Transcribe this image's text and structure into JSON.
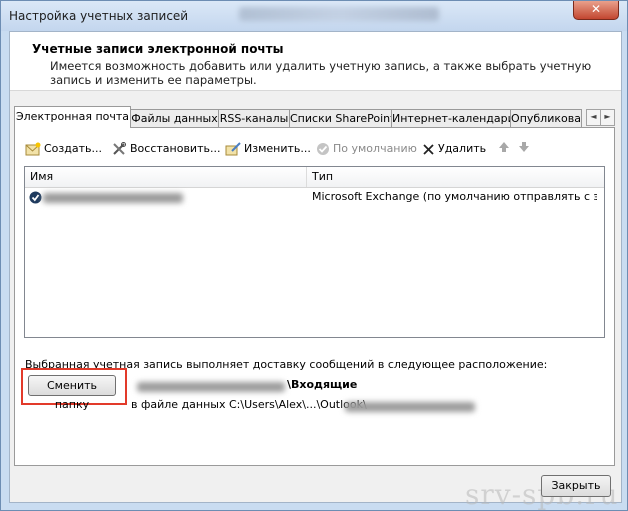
{
  "window": {
    "title": "Настройка учетных записей",
    "close_glyph": "✕"
  },
  "header": {
    "title": "Учетные записи электронной почты",
    "description": "Имеется возможность добавить или удалить учетную запись, а также выбрать учетную запись и изменить ее параметры."
  },
  "tabs": [
    {
      "label": "Электронная почта"
    },
    {
      "label": "Файлы данных"
    },
    {
      "label": "RSS-каналы"
    },
    {
      "label": "Списки SharePoint"
    },
    {
      "label": "Интернет-календари"
    },
    {
      "label": "Опубликова"
    }
  ],
  "tab_scroll": {
    "left": "◄",
    "right": "►"
  },
  "toolbar": {
    "create": "Создать...",
    "repair": "Восстановить...",
    "change": "Изменить...",
    "default": "По умолчанию",
    "delete": "Удалить"
  },
  "list": {
    "col_name": "Имя",
    "col_type": "Тип",
    "rows": [
      {
        "type": "Microsoft Exchange (по умолчанию отправлять с э..."
      }
    ]
  },
  "delivery": {
    "text": "Выбранная учетная запись выполняет доставку сообщений в следующее расположение:",
    "change_folder_button": "Сменить папку",
    "inbox_label": "\\Входящие",
    "datafile_text": "в файле данных C:\\Users\\Alex\\...\\Outlook\\"
  },
  "footer": {
    "close_button": "Закрыть"
  },
  "watermark": "srv-spb.ru",
  "colors": {
    "highlight_frame": "#e23a2a",
    "title_bar": "#c9dcf1"
  }
}
